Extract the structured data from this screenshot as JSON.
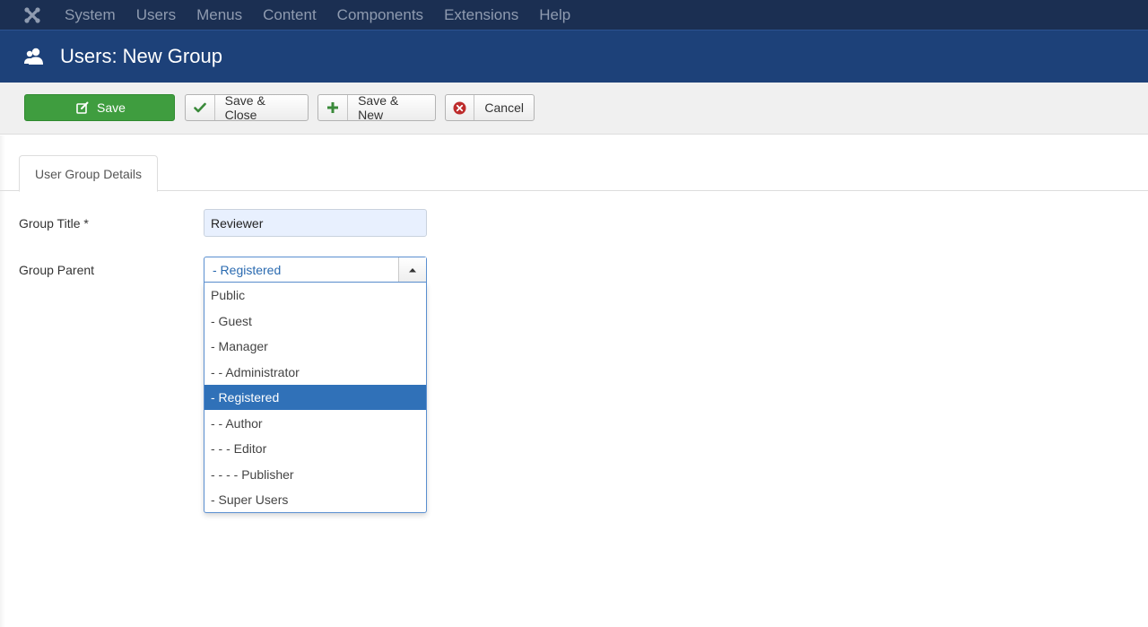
{
  "topnav": {
    "logo_icon": "joomla-logo-icon",
    "items": [
      "System",
      "Users",
      "Menus",
      "Content",
      "Components",
      "Extensions",
      "Help"
    ]
  },
  "header": {
    "icon": "users-icon",
    "title": "Users: New Group"
  },
  "toolbar": {
    "save_label": "Save",
    "save_close_label": "Save & Close",
    "save_new_label": "Save & New",
    "cancel_label": "Cancel"
  },
  "tabs": {
    "details_label": "User Group Details"
  },
  "form": {
    "group_title_label": "Group Title *",
    "group_title_value": "Reviewer",
    "group_parent_label": "Group Parent",
    "group_parent_selected": "- Registered",
    "group_parent_options": [
      "Public",
      "- Guest",
      "- Manager",
      "- - Administrator",
      "- Registered",
      "- - Author",
      "- - - Editor",
      "- - - - Publisher",
      "- Super Users"
    ],
    "selected_index": 4
  },
  "colors": {
    "topnav_bg": "#1b2f52",
    "header_bg": "#1d4179",
    "save_green": "#3f9d3f",
    "selected_option": "#3071b8"
  }
}
